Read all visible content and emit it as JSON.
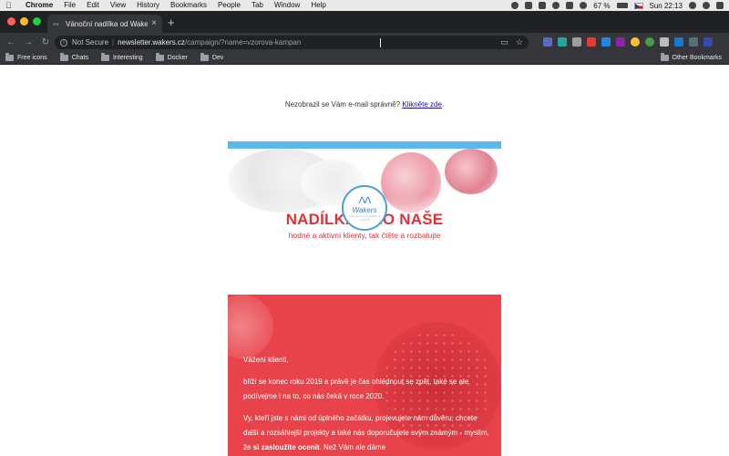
{
  "menubar": {
    "app": "Chrome",
    "items": [
      "File",
      "Edit",
      "View",
      "History",
      "Bookmarks",
      "People",
      "Tab",
      "Window",
      "Help"
    ],
    "battery": "67 %",
    "clock": "Sun 22:13"
  },
  "browser": {
    "tab_title": "Vánoční nadílka od Wakers 🎁",
    "new_tab_symbol": "+",
    "url_security": "Not Secure",
    "url_host": "newsletter.wakers.cz",
    "url_path": "/campaign/?name=vzorova-kampan",
    "bookmarks": [
      "Free icons",
      "Chats",
      "Interesting",
      "Docker",
      "Dev"
    ],
    "other_bookmarks": "Other Bookmarks"
  },
  "email": {
    "notice_text": "Nezobrazil se Vám e-mail správně?",
    "notice_link": "Klikněte zde",
    "notice_end": ".",
    "logo_word": "Wakers",
    "logo_tagline": "vývoj webových aplikací a systémů",
    "headline": "NADÍLKA PRO NAŠE",
    "subheadline": "hodné a aktivní klienty, tak čtěte a rozbalujte",
    "greeting": "Vážení klienti,",
    "para1": "blíží se konec roku 2019 a právě je čas ohlédnout se zpět, také se ale podívejme i na to, co nás čeká v roce 2020.",
    "para2_start": "Vy, kteří jste s námi od úplného začátku, projevujete nám důvěru, chcete další a rozsáhlejší projekty a také nás doporučujete svým známým - myslím, že ",
    "para2_bold": "si zasloužíte ocenit",
    "para2_end": ". Než Vám ale dáme"
  },
  "colors": {
    "accent_red": "#e0313a",
    "section_red": "#e8424a",
    "top_stripe_blue": "#5bb7ee",
    "logo_blue": "#2f7fc1"
  }
}
